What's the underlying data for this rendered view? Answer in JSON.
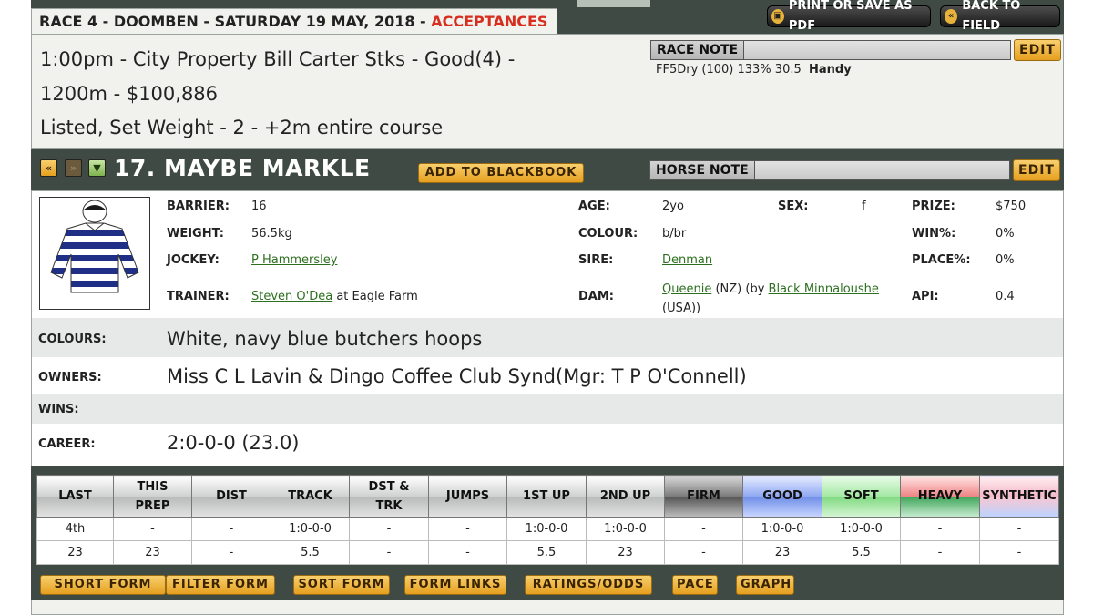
{
  "header": {
    "race_title": "RACE 4 - DOOMBEN - SATURDAY 19 MAY, 2018 - ",
    "status": "ACCEPTANCES",
    "print_label": "PRINT OR SAVE AS PDF",
    "back_label": "BACK TO FIELD"
  },
  "race": {
    "line1": "1:00pm - City Property Bill Carter Stks - Good(4) -",
    "line2": "1200m - $100,886",
    "line3": "Listed, Set Weight - 2 - +2m entire course",
    "note_label": "RACE NOTE",
    "edit_label": "EDIT",
    "note_text": "FF5Dry (100) 133% 30.5",
    "note_bold": "Handy"
  },
  "horse": {
    "name": "17. MAYBE MARKLE",
    "blackbook_label": "ADD TO BLACKBOOK",
    "note_label": "HORSE NOTE",
    "edit_label": "EDIT",
    "nav_prev": "«",
    "nav_next": "»",
    "nav_down": "▼"
  },
  "details": {
    "barrier_label": "BARRIER:",
    "barrier": "16",
    "weight_label": "WEIGHT:",
    "weight": "56.5kg",
    "jockey_label": "JOCKEY:",
    "jockey": "P Hammersley",
    "trainer_label": "TRAINER:",
    "trainer": "Steven O'Dea",
    "trainer_loc": " at Eagle Farm",
    "age_label": "AGE:",
    "age": "2yo",
    "colour_label": "COLOUR:",
    "colour": "b/br",
    "sire_label": "SIRE:",
    "sire": "Denman",
    "dam_label": "DAM:",
    "dam": "Queenie",
    "dam_mid": " (NZ) (by ",
    "dam_sire": "Black Minnaloushe",
    "dam_end": "(USA))",
    "sex_label": "SEX:",
    "sex": "f",
    "prize_label": "PRIZE:",
    "prize": "$750",
    "win_label": "WIN%:",
    "win": "0%",
    "place_label": "PLACE%:",
    "place": "0%",
    "api_label": "API:",
    "api": "0.4",
    "colours_label": "COLOURS:",
    "colours": "White, navy blue butchers hoops",
    "owners_label": "OWNERS:",
    "owners": "Miss C L Lavin & Dingo Coffee Club Synd(Mgr: T P O'Connell)",
    "wins_label": "WINS:",
    "wins": "",
    "career_label": "CAREER:",
    "career": "2:0-0-0 (23.0)"
  },
  "form_table": {
    "headers": [
      "LAST",
      "THIS|PREP",
      "DIST",
      "TRACK",
      "DST &|TRK",
      "JUMPS",
      "1ST UP",
      "2ND UP",
      "FIRM",
      "GOOD",
      "SOFT",
      "HEAVY",
      "SYNTHETIC"
    ],
    "rows": [
      [
        "4th",
        "-",
        "-",
        "1:0-0-0",
        "-",
        "-",
        "1:0-0-0",
        "1:0-0-0",
        "-",
        "1:0-0-0",
        "1:0-0-0",
        "-",
        "-"
      ],
      [
        "23",
        "23",
        "-",
        "5.5",
        "-",
        "-",
        "5.5",
        "23",
        "-",
        "23",
        "5.5",
        "-",
        "-"
      ]
    ]
  },
  "bottom_buttons": [
    "SHORT FORM",
    "FILTER FORM",
    "SORT FORM",
    "FORM LINKS",
    "RATINGS/ODDS",
    "PACE",
    "GRAPH"
  ],
  "colors": {
    "accent_red": "#d72e1f",
    "link_green": "#2c6f1f",
    "button_orange": "#e59f1f",
    "dark_bg": "#3f4a44"
  }
}
